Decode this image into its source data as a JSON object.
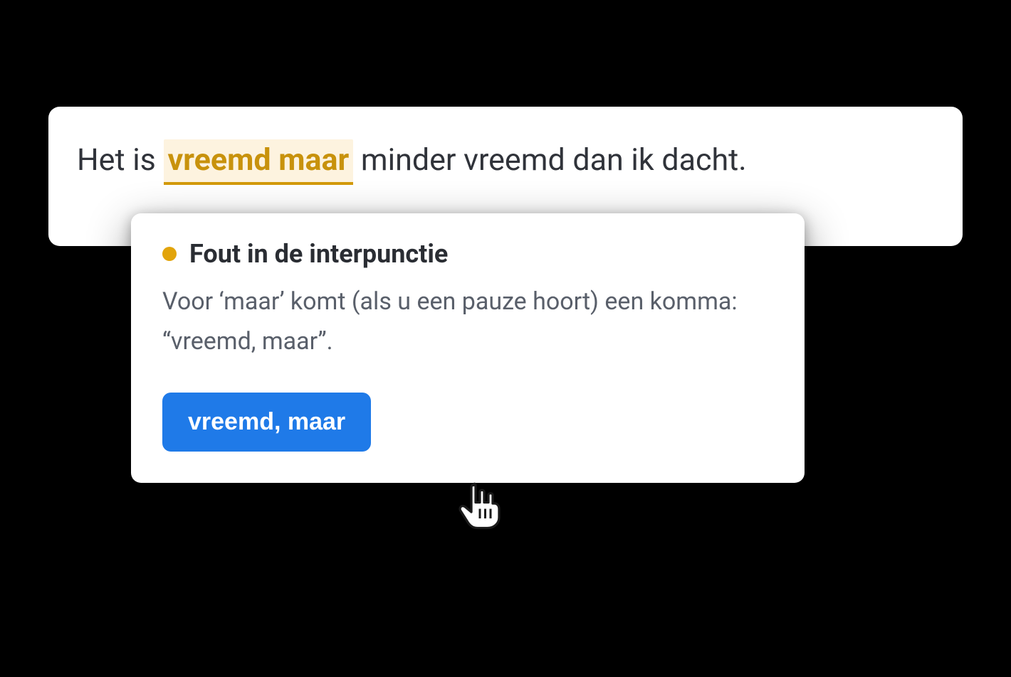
{
  "sentence": {
    "before": "Het is ",
    "highlight": "vreemd maar",
    "after": " minder vreemd dan ik dacht."
  },
  "colors": {
    "accent": "#e2a40b",
    "underline": "#d39a0a",
    "highlight_bg": "#fdf3df",
    "button": "#1f7ae8"
  },
  "tooltip": {
    "category": "Fout in de interpunctie",
    "description": "Voor ‘maar’ komt (als u een pauze hoort) een komma: “vreemd, maar”.",
    "suggestion": "vreemd, maar"
  }
}
